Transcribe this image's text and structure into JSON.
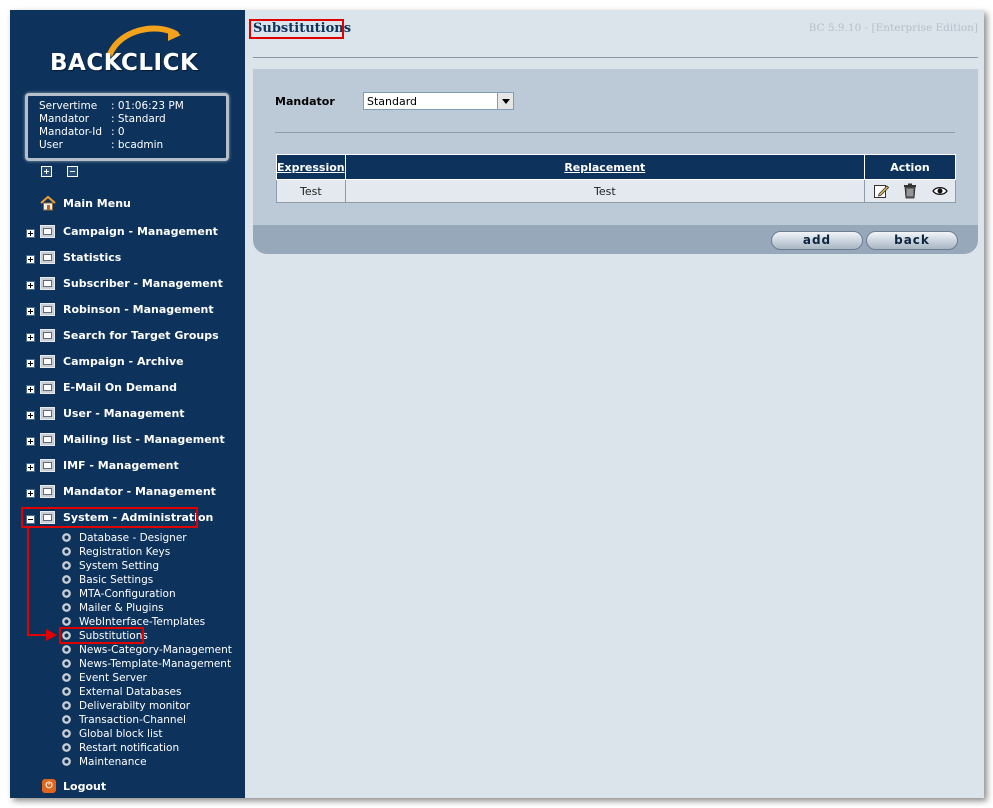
{
  "brand": {
    "logo_text": "BACKCLICK"
  },
  "session": {
    "rows": [
      {
        "key": "Servertime",
        "value": ": 01:06:23 PM"
      },
      {
        "key": "Mandator",
        "value": ": Standard"
      },
      {
        "key": "Mandator-Id",
        "value": ": 0"
      },
      {
        "key": "User",
        "value": ": bcadmin"
      }
    ]
  },
  "nav": {
    "main_menu": "Main Menu",
    "items": [
      "Campaign - Management",
      "Statistics",
      "Subscriber - Management",
      "Robinson - Management",
      "Search for Target Groups",
      "Campaign - Archive",
      "E-Mail On Demand",
      "User - Management",
      "Mailing list - Management",
      "IMF - Management",
      "Mandator - Management",
      "System - Administration"
    ],
    "sub_items": [
      "Database - Designer",
      "Registration Keys",
      "System Setting",
      "Basic Settings",
      "MTA-Configuration",
      "Mailer & Plugins",
      "WebInterface-Templates",
      "Substitutions",
      "News-Category-Management",
      "News-Template-Management",
      "Event Server",
      "External Databases",
      "Deliverabilty monitor",
      "Transaction-Channel",
      "Global block list",
      "Restart notification",
      "Maintenance"
    ],
    "logout": "Logout"
  },
  "page": {
    "title": "Substitutions",
    "version": "BC 5.9.10 - [Enterprise Edition]"
  },
  "form": {
    "mandator_label": "Mandator",
    "mandator_value": "Standard"
  },
  "table": {
    "headers": [
      "Expression",
      "Replacement",
      "Action"
    ],
    "rows": [
      {
        "expression": "Test",
        "replacement": "Test"
      }
    ]
  },
  "buttons": {
    "add": "add",
    "back": "back"
  },
  "icons": {
    "edit": "edit-icon",
    "delete": "trash-icon",
    "view": "eye-icon",
    "home": "home-icon",
    "logout": "power-icon",
    "folder": "folder-icon",
    "gear": "gear-icon"
  },
  "colors": {
    "sidebar": "#0d325c",
    "highlight": "#e00000",
    "panel": "#bccad8"
  }
}
